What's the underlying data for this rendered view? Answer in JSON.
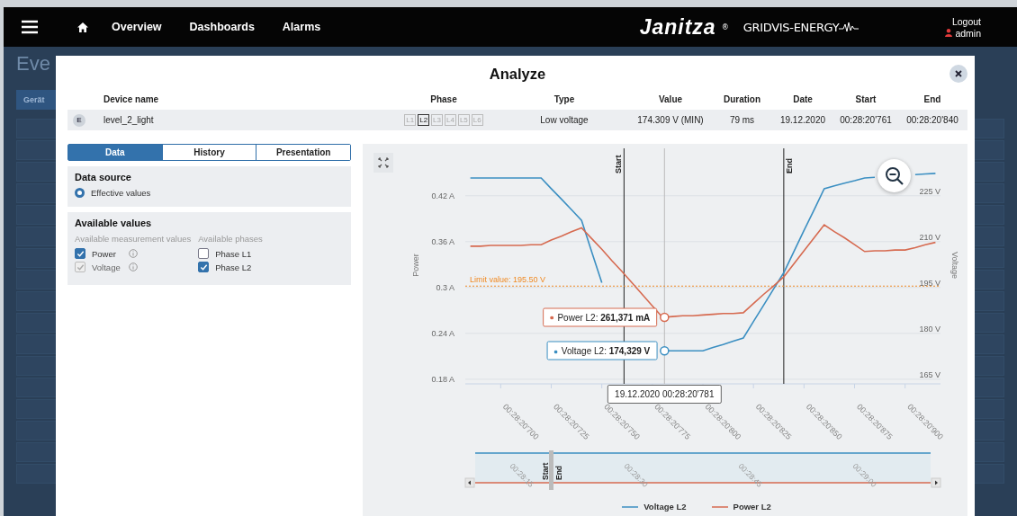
{
  "nav": {
    "links": [
      {
        "label": "Overview"
      },
      {
        "label": "Dashboards"
      },
      {
        "label": "Alarms"
      }
    ],
    "brand": "Janitza",
    "brand_mark": "®",
    "product": "GRIDVIS-ENERGY",
    "logout": "Logout",
    "user": "admin"
  },
  "background": {
    "title": "Eve",
    "button": "Gerät"
  },
  "dialog": {
    "title": "Analyze",
    "columns": [
      "Device name",
      "Phase",
      "Type",
      "Value",
      "Duration",
      "Date",
      "Start",
      "End"
    ],
    "event": {
      "badge": "E",
      "device": "level_2_light",
      "phases": [
        {
          "label": "L1",
          "selected": false
        },
        {
          "label": "L2",
          "selected": true
        },
        {
          "label": "L3",
          "selected": false
        },
        {
          "label": "L4",
          "selected": false
        },
        {
          "label": "L5",
          "selected": false
        },
        {
          "label": "L6",
          "selected": false
        }
      ],
      "type": "Low voltage",
      "value": "174.309 V (MIN)",
      "duration": "79 ms",
      "date": "19.12.2020",
      "start": "00:28:20'761",
      "end": "00:28:20'840"
    },
    "tabs": [
      {
        "label": "Data",
        "selected": true
      },
      {
        "label": "History",
        "selected": false
      },
      {
        "label": "Presentation",
        "selected": false
      }
    ],
    "data_source": {
      "title": "Data source",
      "options": [
        {
          "label": "Effective values",
          "selected": true
        }
      ]
    },
    "available": {
      "title": "Available values",
      "measurements": {
        "heading": "Available measurement values",
        "items": [
          {
            "label": "Power",
            "checked": true,
            "disabled": false
          },
          {
            "label": "Voltage",
            "checked": true,
            "disabled": true
          }
        ]
      },
      "phases": {
        "heading": "Available phases",
        "items": [
          {
            "label": "Phase L1",
            "checked": false
          },
          {
            "label": "Phase L2",
            "checked": true
          }
        ]
      }
    },
    "chart": {
      "chart_data": {
        "type": "line",
        "ylabel": "Power",
        "y2label": "Voltage",
        "categories": [
          null,
          null,
          null,
          "00:28:20'700",
          null,
          null,
          null,
          null,
          "00:28:20'725",
          null,
          null,
          null,
          null,
          "00:28:20'750",
          null,
          null,
          null,
          null,
          "00:28:20'775",
          null,
          null,
          null,
          null,
          "00:28:20'800",
          null,
          null,
          null,
          null,
          "00:28:20'825",
          null,
          null,
          null,
          null,
          "00:28:20'850",
          null,
          null,
          null,
          null,
          "00:28:20'875",
          null,
          null,
          null,
          null,
          "00:28:20'900",
          null,
          null,
          null
        ],
        "ylim": [
          0.174,
          0.482
        ],
        "yticks": [
          {
            "value": 0.18,
            "label": "0.18 A"
          },
          {
            "value": 0.24,
            "label": "0.24 A"
          },
          {
            "value": 0.3,
            "label": "0.3 A"
          },
          {
            "value": 0.36,
            "label": "0.36 A"
          },
          {
            "value": 0.42,
            "label": "0.42 A"
          }
        ],
        "y2lim": [
          163.5,
          240.6
        ],
        "y2ticks": [
          {
            "value": 165,
            "label": "165 V"
          },
          {
            "value": 180,
            "label": "180 V"
          },
          {
            "value": 195,
            "label": "195 V"
          },
          {
            "value": 210,
            "label": "210 V"
          },
          {
            "value": 225,
            "label": "225 V"
          }
        ],
        "series": [
          {
            "name": "Voltage L2",
            "color": "#3b8fc2",
            "axis": "y2",
            "values": [
              230.9,
              230.9,
              230.9,
              230.9,
              230.9,
              230.9,
              230.9,
              230.9,
              227.4,
              224.0,
              220.5,
              217.0,
              206.8,
              196.6,
              null,
              null,
              null,
              null,
              null,
              174.3,
              174.3,
              174.3,
              174.3,
              174.3,
              175.4,
              176.4,
              177.5,
              178.5,
              183.9,
              189.2,
              194.6,
              199.9,
              206.8,
              213.7,
              220.5,
              227.4,
              228.3,
              229.2,
              230.0,
              230.9,
              231.1,
              null,
              null,
              null,
              232.0,
              232.2,
              232.4
            ]
          },
          {
            "name": "Power L2",
            "color": "#d66a50",
            "values": [
              0.354,
              0.354,
              0.355,
              0.355,
              0.355,
              0.355,
              0.356,
              0.356,
              0.362,
              0.367,
              0.373,
              0.378,
              0.364,
              0.35,
              0.335,
              0.321,
              0.306,
              0.291,
              0.276,
              0.261,
              0.262,
              0.263,
              0.263,
              0.264,
              0.265,
              0.266,
              0.266,
              0.267,
              0.279,
              0.291,
              0.302,
              0.314,
              0.331,
              0.348,
              0.365,
              0.382,
              0.373,
              0.365,
              0.356,
              0.347,
              0.348,
              0.348,
              0.349,
              0.349,
              0.352,
              0.356,
              0.359
            ]
          }
        ],
        "grid": true,
        "ref_lines": [
          {
            "axis": "y2",
            "value": 195.5,
            "label": "Limit value: 195.50 V",
            "color": "#f08a24"
          }
        ]
      },
      "markers": [
        {
          "label": "Start"
        },
        {
          "label": "End"
        }
      ],
      "tooltips": [
        "Power L2: **261,371 mA**",
        "Voltage L2: **174,329 V**"
      ],
      "date_tooltip": "19.12.2020 00:28:20'781",
      "navigator": {
        "labels": [
          "00:28:15",
          "00:28:30",
          "00:28:45",
          "00:29:00"
        ],
        "start": "Start",
        "end": "End"
      }
    }
  }
}
